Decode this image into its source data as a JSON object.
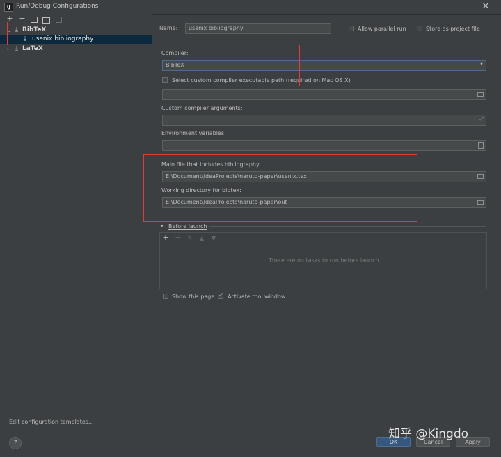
{
  "window": {
    "title": "Run/Debug Configurations"
  },
  "toolbar_icons": [
    "add-icon",
    "remove-icon",
    "copy-icon",
    "folder-icon",
    "sort-icon"
  ],
  "tree": {
    "items": [
      {
        "label": "BibTeX",
        "expanded": true
      },
      {
        "label": "usenix bibliography",
        "selected": true
      },
      {
        "label": "LaTeX",
        "expanded": false
      }
    ]
  },
  "footer_left": {
    "edit_templates": "Edit configuration templates...",
    "help": "?"
  },
  "header": {
    "name_label": "Name:",
    "name_value": "usenix bibliography",
    "allow_parallel": "Allow parallel run",
    "store_project": "Store as project file"
  },
  "compiler": {
    "label": "Compiler:",
    "value": "BibTeX",
    "custom_path_label": "Select custom compiler executable path (required on Mac OS X)",
    "custom_path_value": ""
  },
  "arguments": {
    "label": "Custom compiler arguments:",
    "value": ""
  },
  "env": {
    "label": "Environment variables:",
    "value": ""
  },
  "main_file": {
    "label": "Main file that includes bibliography:",
    "value": "E:\\Document\\IdeaProjects\\naruto-paper\\usenix.tex"
  },
  "working_dir": {
    "label": "Working directory for bibtex:",
    "value": "E:\\Document\\IdeaProjects\\naruto-paper\\out"
  },
  "before_launch": {
    "title": "Before launch",
    "empty_text": "There are no tasks to run before launch"
  },
  "options": {
    "show_page": "Show this page",
    "activate_tool": "Activate tool window"
  },
  "buttons": {
    "ok": "OK",
    "cancel": "Cancel",
    "apply": "Apply"
  },
  "watermark": "知乎 @Kingdo",
  "colors": {
    "highlight": "#e53935",
    "accent": "#589df6",
    "selected_row": "#0d293e"
  }
}
